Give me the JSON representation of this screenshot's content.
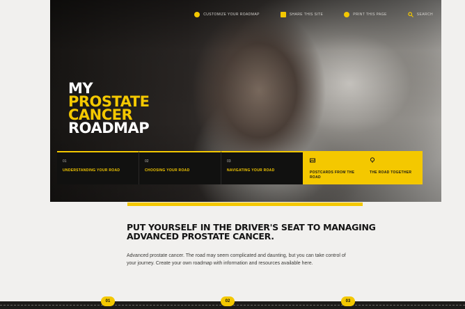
{
  "nav": {
    "items": [
      {
        "label": "Customize your roadmap",
        "icon": "settings-icon"
      },
      {
        "label": "Share this site",
        "icon": "share-icon"
      },
      {
        "label": "Print this page",
        "icon": "print-icon"
      },
      {
        "label": "Search",
        "icon": "search-icon"
      }
    ]
  },
  "hero": {
    "title_lines": [
      "MY",
      "PROSTATE",
      "CANCER",
      "ROADMAP"
    ]
  },
  "road_steps": [
    {
      "num": "01",
      "label": "Understanding your road"
    },
    {
      "num": "02",
      "label": "Choosing your road"
    },
    {
      "num": "03",
      "label": "Navigating your road"
    }
  ],
  "extras": [
    {
      "label": "Postcards from the road",
      "icon": "postcard-icon"
    },
    {
      "label": "The road together",
      "icon": "pin-icon"
    }
  ],
  "intro": {
    "headline": "PUT YOURSELF IN THE DRIVER'S SEAT TO MANAGING ADVANCED PROSTATE CANCER.",
    "body": "Advanced prostate cancer. The road may seem complicated and daunting, but you can take control of your journey. Create your own roadmap with information and resources available here."
  },
  "bottom_markers": [
    "01",
    "02",
    "03"
  ],
  "colors": {
    "accent": "#f4c800",
    "dark": "#111110"
  }
}
